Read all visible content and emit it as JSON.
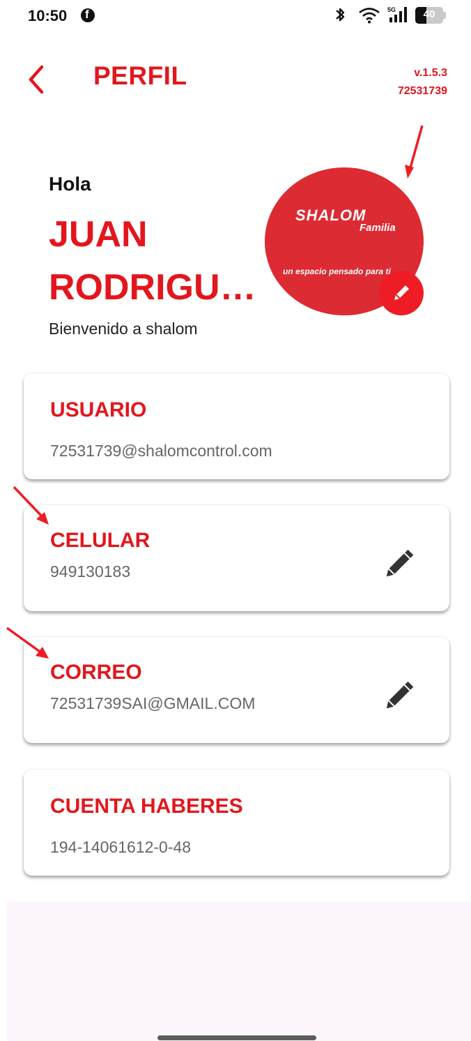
{
  "status_bar": {
    "time": "10:50",
    "battery_level": "40",
    "battery_fraction": 0.4,
    "icons": [
      "facebook-icon",
      "bluetooth-icon",
      "wifi-icon",
      "signal-icon",
      "battery-icon"
    ]
  },
  "header": {
    "title": "PERFIL",
    "version": "v.1.5.3",
    "user_code": "72531739"
  },
  "profile": {
    "greeting": "Hola",
    "name": "JUAN RODRIGU…",
    "welcome": "Bienvenido a shalom",
    "avatar": {
      "brand": "SHALOM",
      "sub": "Familia",
      "slogan": "un espacio pensado para ti"
    }
  },
  "cards": {
    "usuario": {
      "label": "USUARIO",
      "value": "72531739@shalomcontrol.com"
    },
    "celular": {
      "label": "CELULAR",
      "value": "949130183"
    },
    "correo": {
      "label": "CORREO",
      "value": "72531739SAI@GMAIL.COM"
    },
    "cuenta": {
      "label": "CUENTA HABERES",
      "value": "194-14061612-0-48"
    }
  },
  "colors": {
    "accent": "#e3161d",
    "avatar_bg": "#dc2b33",
    "edit_fab": "#ee1c24",
    "value_text": "#666666",
    "bottom_panel": "#fcf6fc"
  }
}
